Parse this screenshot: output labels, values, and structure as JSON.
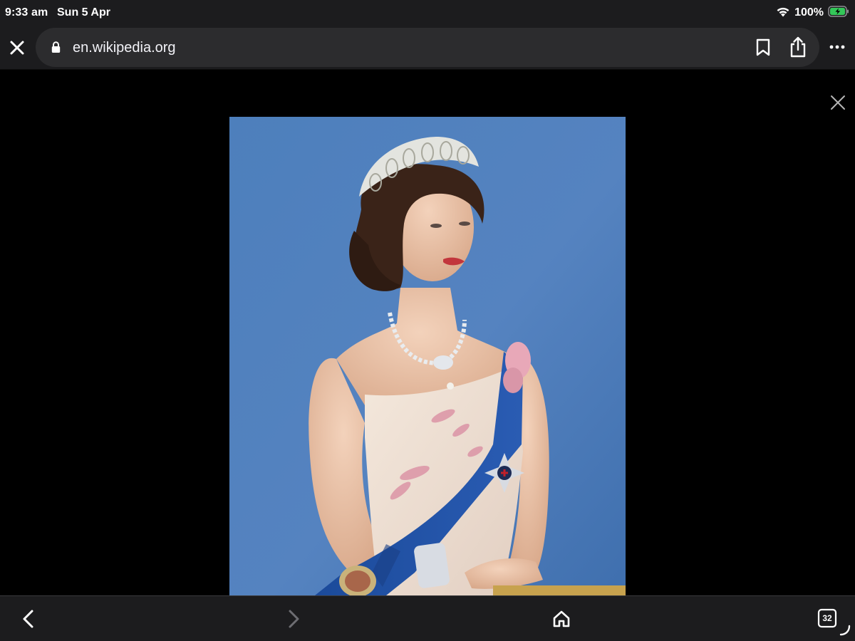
{
  "status_bar": {
    "time": "9:33 am",
    "date": "Sun 5 Apr",
    "battery_percent": "100%",
    "wifi_icon": "wifi-icon",
    "battery_icon": "battery-charging-icon"
  },
  "toolbar": {
    "url": "en.wikipedia.org",
    "close_icon": "close-icon",
    "lock_icon": "lock-icon",
    "bookmark_icon": "bookmark-icon",
    "share_icon": "share-icon",
    "more_icon": "more-icon"
  },
  "viewer": {
    "close_icon": "close-icon",
    "image_subject": "portrait-photo"
  },
  "bottom_bar": {
    "back_icon": "chevron-left-icon",
    "forward_icon": "chevron-right-icon",
    "home_icon": "home-icon",
    "tabs_count": "32"
  },
  "colors": {
    "bar_background": "#1c1c1e",
    "url_field": "#2c2c2e",
    "viewer_background": "#000000",
    "photo_background": "#4a78b4",
    "battery_green": "#34c759"
  }
}
